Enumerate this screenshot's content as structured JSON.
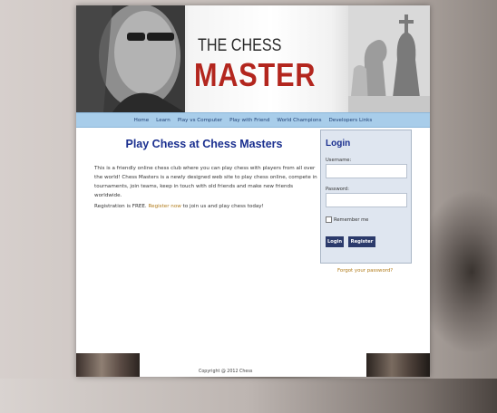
{
  "header": {
    "logo_line1": "THE CHESS",
    "logo_line2": "MASTER"
  },
  "nav": {
    "items": [
      {
        "label": "Home"
      },
      {
        "label": "Learn"
      },
      {
        "label": "Play vs Computer"
      },
      {
        "label": "Play with Friend"
      },
      {
        "label": "World Champions"
      },
      {
        "label": "Developers Links"
      }
    ]
  },
  "main": {
    "title": "Play Chess at Chess Masters",
    "intro": "This is a friendly online chess club where you can play chess with players from all over the world! Chess Masters is a newly designed web site to play chess online, compete in tournaments, join teams, keep in touch with old friends and make new friends worldwide.",
    "reg_prefix": "Registration is FREE.",
    "reg_link": "Register now",
    "reg_suffix": "to join us and play chess today!"
  },
  "login": {
    "title": "Login",
    "username_label": "Username:",
    "username_value": "",
    "password_label": "Password:",
    "password_value": "",
    "remember_label": "Remember me",
    "login_button": "Login",
    "register_button": "Register",
    "forgot_link": "Forgot your password?"
  },
  "footer": {
    "copyright": "Copyright @ 2012 Chess"
  },
  "colors": {
    "title_blue": "#1a2f8f",
    "logo_red": "#b3261e",
    "nav_bg": "#a8cdea",
    "button_bg": "#2b3a6b",
    "link_gold": "#b07a18"
  },
  "icons": {
    "checkbox": "checkbox-icon"
  }
}
